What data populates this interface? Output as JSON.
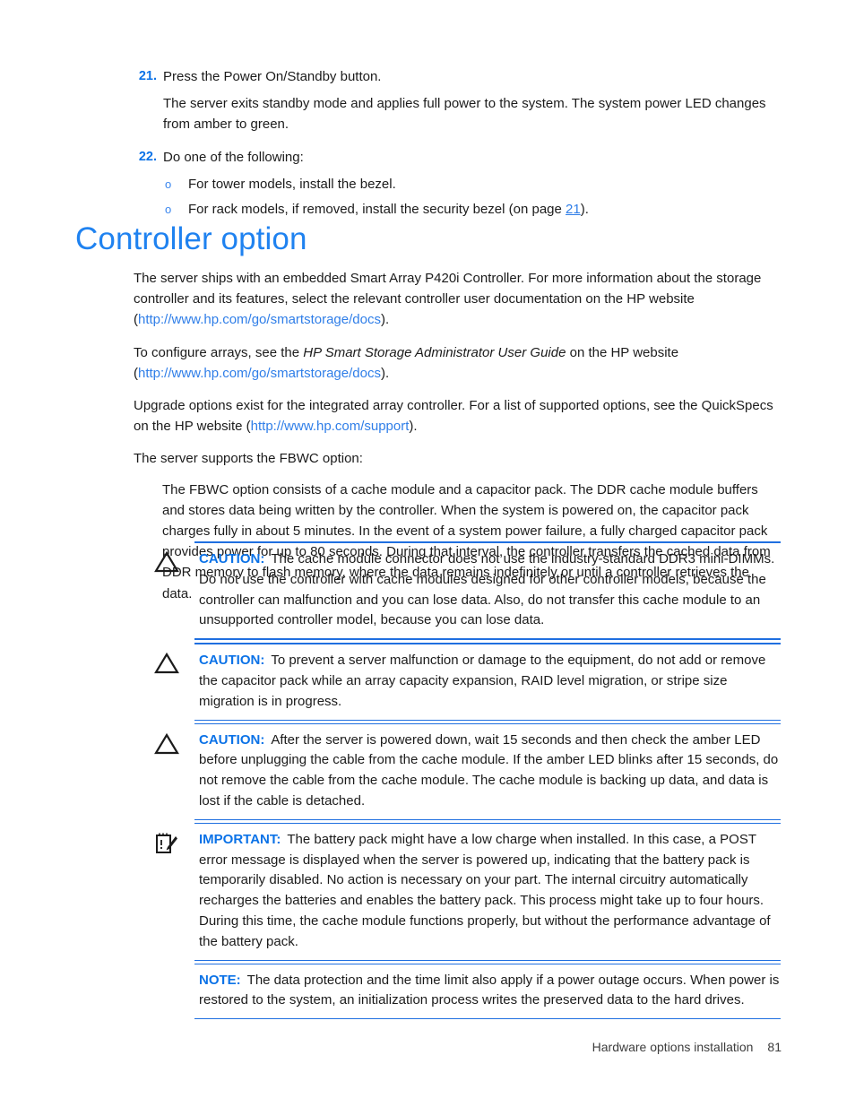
{
  "steps": [
    {
      "number": "21.",
      "text": "Press the Power On/Standby button.",
      "body": "The server exits standby mode and applies full power to the system. The system power LED changes from amber to green."
    },
    {
      "number": "22.",
      "text": "Do one of the following:",
      "sub": [
        {
          "bullet": "o",
          "text": "For tower models, install the bezel."
        },
        {
          "bullet": "o",
          "pre": "For rack models, if removed, install the security bezel (on page ",
          "page_ref": "21",
          "post": ")."
        }
      ]
    }
  ],
  "heading": "Controller option",
  "paragraphs": {
    "p1_pre": "The server ships with an embedded Smart Array P420i Controller. For more information about the storage controller and its features, select the relevant controller user documentation on the HP website (",
    "p1_link": "http://www.hp.com/go/smartstorage/docs",
    "p1_post": ").",
    "p2_pre": "To configure arrays, see the ",
    "p2_italic": "HP Smart Storage Administrator User Guide",
    "p2_mid": " on the HP website (",
    "p2_link": "http://www.hp.com/go/smartstorage/docs",
    "p2_post": ").",
    "p3_pre": "Upgrade options exist for the integrated array controller. For a list of supported options, see the QuickSpecs on the HP website (",
    "p3_link": "http://www.hp.com/support",
    "p3_post": ").",
    "p4": "The server supports the FBWC option:",
    "p5": "The FBWC option consists of a cache module and a capacitor pack. The DDR cache module buffers and stores data being written by the controller. When the system is powered on, the capacitor pack charges fully in about 5 minutes. In the event of a system power failure, a fully charged capacitor pack provides power for up to 80 seconds. During that interval, the controller transfers the cached data from DDR memory to flash memory, where the data remains indefinitely or until a controller retrieves the data."
  },
  "admonitions": [
    {
      "icon": "caution-triangle-icon",
      "label": "CAUTION:",
      "text": "The cache module connector does not use the industry-standard DDR3 mini-DIMMs. Do not use the controller with cache modules designed for other controller models, because the controller can malfunction and you can lose data. Also, do not transfer this cache module to an unsupported controller model, because you can lose data."
    },
    {
      "icon": "caution-triangle-icon",
      "label": "CAUTION:",
      "text": "To prevent a server malfunction or damage to the equipment, do not add or remove the capacitor pack while an array capacity expansion, RAID level migration, or stripe size migration is in progress."
    },
    {
      "icon": "caution-triangle-icon",
      "label": "CAUTION:",
      "text": "After the server is powered down, wait 15 seconds and then check the amber LED before unplugging the cable from the cache module. If the amber LED blinks after 15 seconds, do not remove the cable from the cache module. The cache module is backing up data, and data is lost if the cable is detached."
    },
    {
      "icon": "important-notepad-icon",
      "label": "IMPORTANT:",
      "text": "The battery pack might have a low charge when installed. In this case, a POST error message is displayed when the server is powered up, indicating that the battery pack is temporarily disabled. No action is necessary on your part. The internal circuitry automatically recharges the batteries and enables the battery pack. This process might take up to four hours. During this time, the cache module functions properly, but without the performance advantage of the battery pack."
    },
    {
      "icon": "none",
      "label": "NOTE:",
      "text": "The data protection and the time limit also apply if a power outage occurs. When power is restored to the system, an initialization process writes the preserved data to the hard drives."
    }
  ],
  "footer": {
    "title": "Hardware options installation",
    "page_number": "81"
  },
  "colors": {
    "heading_blue": "#1f82f0",
    "label_blue": "#0b72e7",
    "link_blue": "#2f7ee8",
    "rule_blue": "#1f6fe0",
    "body_text": "#1b1b1b"
  }
}
